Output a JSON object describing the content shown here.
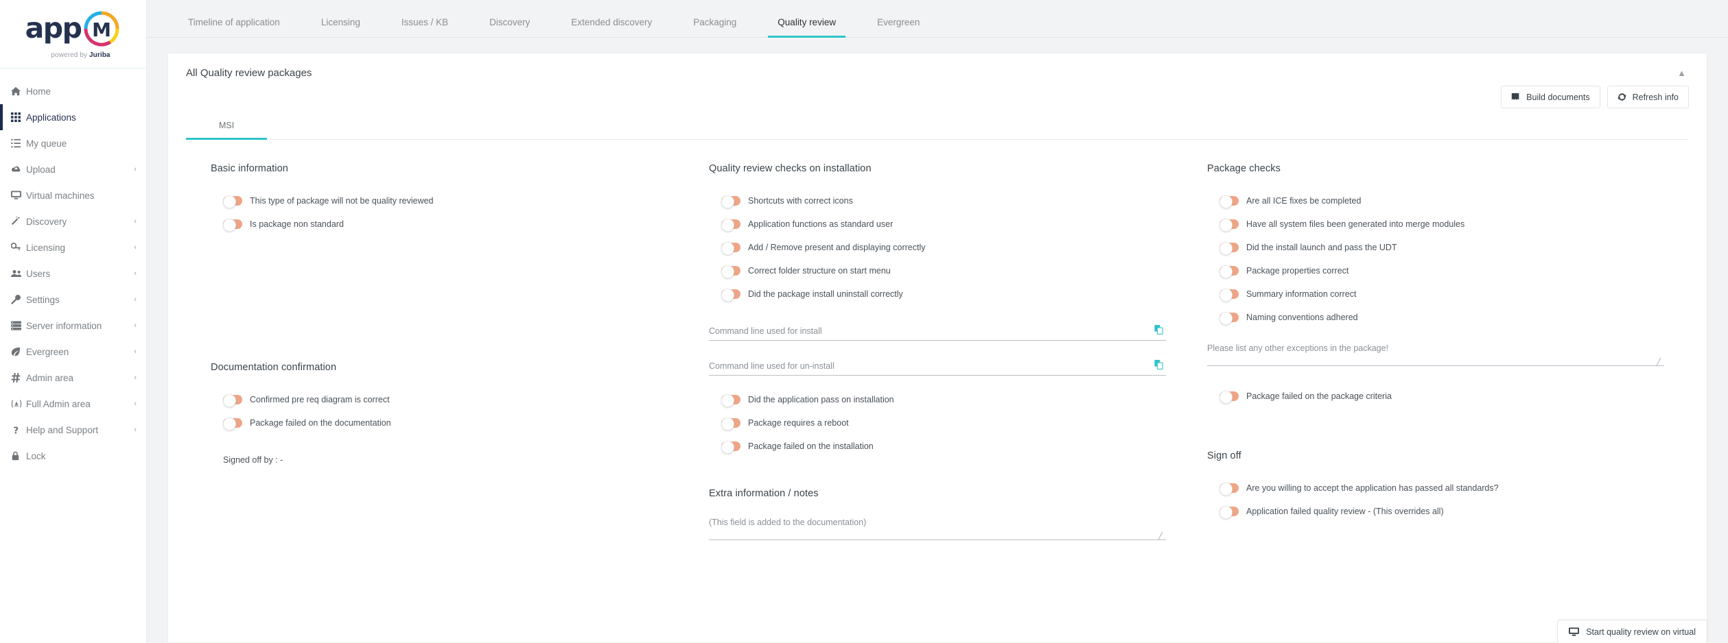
{
  "brand": {
    "name": "app",
    "mark": "M",
    "tagline_prefix": "powered by ",
    "tagline_brand": "Juriba",
    "accent_teal": "#2ec4c8",
    "accent_salmon": "#efa585",
    "navy": "#25324f"
  },
  "sidebar": {
    "items": [
      {
        "label": "Home",
        "icon": "home-icon",
        "caret": "",
        "active": false
      },
      {
        "label": "Applications",
        "icon": "grid-icon",
        "caret": "",
        "active": true
      },
      {
        "label": "My queue",
        "icon": "list-ol-icon",
        "caret": "",
        "active": false
      },
      {
        "label": "Upload",
        "icon": "cloud-upload-icon",
        "caret": "‹",
        "active": false
      },
      {
        "label": "Virtual machines",
        "icon": "desktop-icon",
        "caret": "",
        "active": false
      },
      {
        "label": "Discovery",
        "icon": "magic-wand-icon",
        "caret": "‹",
        "active": false
      },
      {
        "label": "Licensing",
        "icon": "key-icon",
        "caret": "‹",
        "active": false
      },
      {
        "label": "Users",
        "icon": "users-icon",
        "caret": "‹",
        "active": false
      },
      {
        "label": "Settings",
        "icon": "wrench-icon",
        "caret": "‹",
        "active": false
      },
      {
        "label": "Server information",
        "icon": "server-icon",
        "caret": "‹",
        "active": false
      },
      {
        "label": "Evergreen",
        "icon": "leaf-icon",
        "caret": "‹",
        "active": false
      },
      {
        "label": "Admin area",
        "icon": "hashtag-icon",
        "caret": "‹",
        "active": false
      },
      {
        "label": "Full Admin area",
        "icon": "full-admin-icon",
        "caret": "‹",
        "active": false
      },
      {
        "label": "Help and Support",
        "icon": "question-icon",
        "caret": "‹",
        "active": false
      },
      {
        "label": "Lock",
        "icon": "lock-icon",
        "caret": "",
        "active": false
      }
    ]
  },
  "tabs": [
    {
      "label": "Timeline of application",
      "active": false
    },
    {
      "label": "Licensing",
      "active": false
    },
    {
      "label": "Issues / KB",
      "active": false
    },
    {
      "label": "Discovery",
      "active": false
    },
    {
      "label": "Extended discovery",
      "active": false
    },
    {
      "label": "Packaging",
      "active": false
    },
    {
      "label": "Quality review",
      "active": true
    },
    {
      "label": "Evergreen",
      "active": false
    }
  ],
  "card": {
    "title": "All Quality review packages",
    "collapse_icon": "chevron-up-icon",
    "buttons": [
      {
        "label": "Build documents",
        "icon": "book-icon"
      },
      {
        "label": "Refresh info",
        "icon": "refresh-icon"
      }
    ],
    "subtabs": [
      {
        "label": "MSI",
        "active": true
      }
    ]
  },
  "sections": {
    "basic_information": {
      "title": "Basic information",
      "toggles": [
        {
          "label": "This type of package will not be quality reviewed",
          "on": false
        },
        {
          "label": "Is package non standard",
          "on": false
        }
      ]
    },
    "quality_review_checks": {
      "title": "Quality review checks on installation",
      "toggles_top": [
        {
          "label": "Shortcuts with correct icons",
          "on": false
        },
        {
          "label": "Application functions as standard user",
          "on": false
        },
        {
          "label": "Add / Remove present and displaying correctly",
          "on": false
        },
        {
          "label": "Correct folder structure on start menu",
          "on": false
        },
        {
          "label": "Did the package install uninstall correctly",
          "on": false
        }
      ],
      "install_cmd": {
        "placeholder": "Command line used for install",
        "value": "",
        "copy_icon": "copy-icon"
      },
      "uninstall_cmd": {
        "placeholder": "Command line used for un-install",
        "value": "",
        "copy_icon": "copy-icon"
      },
      "toggles_bottom": [
        {
          "label": "Did the application pass on installation",
          "on": false
        },
        {
          "label": "Package requires a reboot",
          "on": false
        },
        {
          "label": "Package failed on the installation",
          "on": false
        }
      ]
    },
    "package_checks": {
      "title": "Package checks",
      "toggles": [
        {
          "label": "Are all ICE fixes be completed",
          "on": false
        },
        {
          "label": "Have all system files been generated into merge modules",
          "on": false
        },
        {
          "label": "Did the install launch and pass the UDT",
          "on": false
        },
        {
          "label": "Package properties correct",
          "on": false
        },
        {
          "label": "Summary information correct",
          "on": false
        },
        {
          "label": "Naming conventions adhered",
          "on": false
        }
      ],
      "exceptions": {
        "placeholder": "Please list any other exceptions in the package!",
        "value": ""
      },
      "toggles_bottom": [
        {
          "label": "Package failed on the package criteria",
          "on": false
        }
      ]
    },
    "documentation_confirmation": {
      "title": "Documentation confirmation",
      "toggles": [
        {
          "label": "Confirmed pre req diagram is correct",
          "on": false
        },
        {
          "label": "Package failed on the documentation",
          "on": false
        }
      ],
      "signed_off_by": "Signed off by :  -"
    },
    "extra_information": {
      "title": "Extra information / notes",
      "notes": {
        "placeholder": "(This field is added to the documentation)",
        "value": ""
      }
    },
    "sign_off": {
      "title": "Sign off",
      "toggles": [
        {
          "label": "Are you willing to accept the application has passed all standards?",
          "on": false
        },
        {
          "label": "Application failed quality review - (This overrides all)",
          "on": false
        }
      ]
    }
  },
  "footer_action": {
    "label": "Start quality review on virtual",
    "icon": "desktop-icon"
  }
}
